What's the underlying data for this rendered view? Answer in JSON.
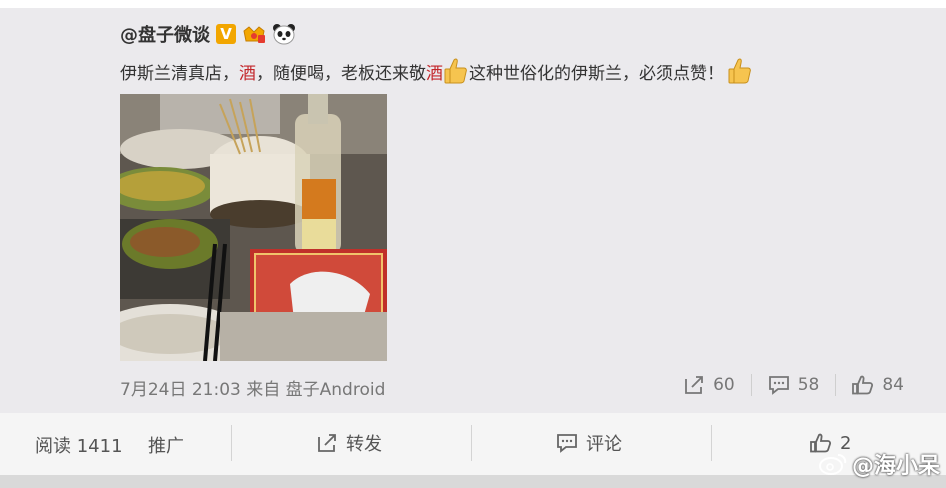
{
  "post": {
    "author": "@盘子微谈",
    "badges": {
      "verified": "V",
      "crown": "crown-badge",
      "panda": "panda-badge"
    },
    "content": {
      "part1": "伊斯兰清真店，",
      "hl1": "酒",
      "part2": "，随便喝，老板还来敬",
      "hl2": "酒",
      "part3": "这种世俗化的伊斯兰，必须点赞！"
    },
    "photo_alt": "hotpot dinner table with liquor bottle",
    "meta": "7月24日 21:03 来自 盘子Android",
    "stats": {
      "reposts": "60",
      "comments": "58",
      "likes": "84"
    }
  },
  "bottom": {
    "read_label": "阅读 1411",
    "promote": "推广",
    "repost": "转发",
    "comment": "评论",
    "likes": "2"
  },
  "watermark": "@海小呆",
  "colors": {
    "highlight": "#c3262a",
    "accent_gold": "#f2a600"
  }
}
